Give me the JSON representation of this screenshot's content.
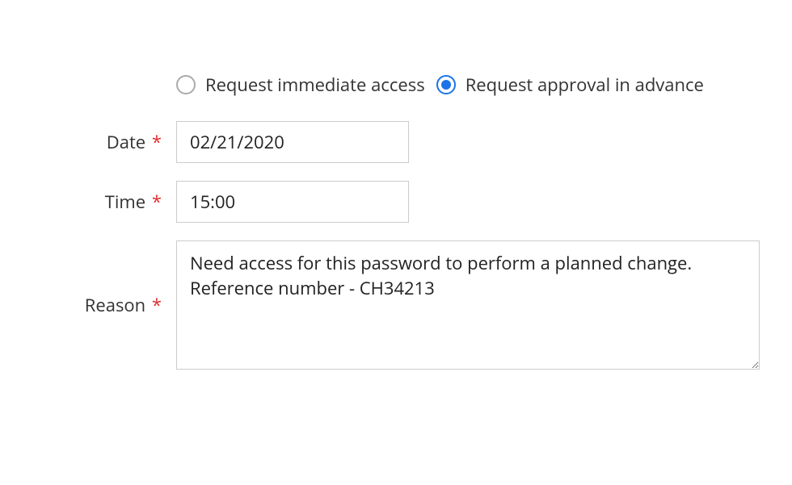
{
  "radios": {
    "immediate": {
      "label": "Request immediate access",
      "selected": false
    },
    "advance": {
      "label": "Request approval in advance",
      "selected": true
    }
  },
  "fields": {
    "date": {
      "label": "Date",
      "required_mark": "*",
      "value": "02/21/2020"
    },
    "time": {
      "label": "Time",
      "required_mark": "*",
      "value": "15:00"
    },
    "reason": {
      "label": "Reason",
      "required_mark": "*",
      "value": "Need access for this password to perform a planned change. Reference number - CH34213"
    }
  }
}
